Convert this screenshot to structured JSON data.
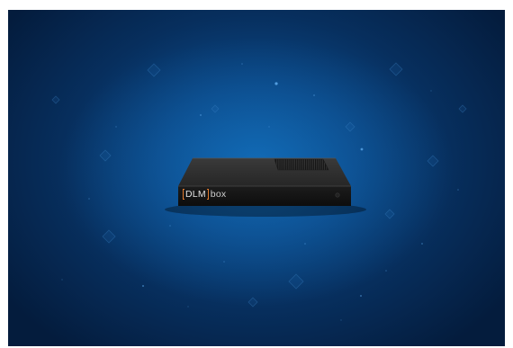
{
  "scene": {
    "background_gradient": [
      "#0c5fa6",
      "#0a4785",
      "#072f5e",
      "#041c3d"
    ],
    "device_body_color": "#2a2a2a",
    "device_front_color": "#141414"
  },
  "device": {
    "logo": {
      "brand": "DLM",
      "product": "box",
      "accent_color": "#e07a2e"
    }
  }
}
